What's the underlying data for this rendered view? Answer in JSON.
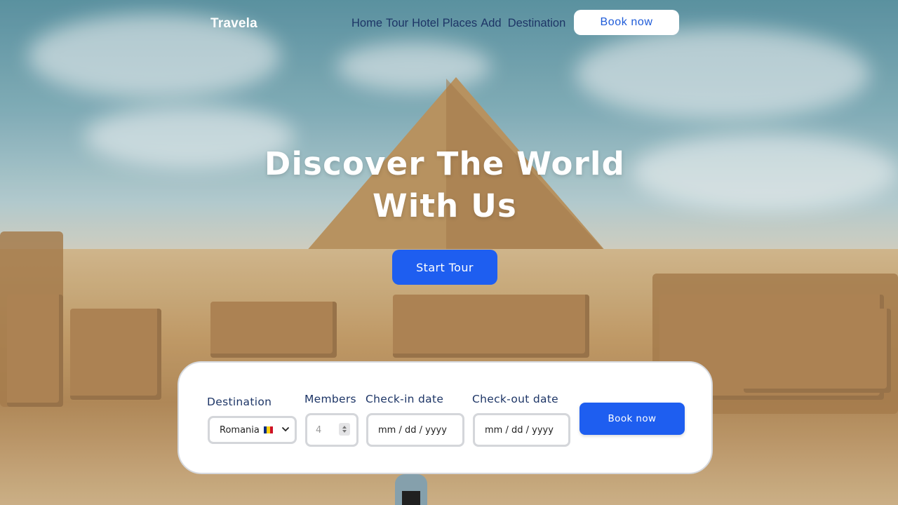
{
  "brand": {
    "name": "Travela",
    "accent": "#1e5ef0",
    "nav_text_color": "#1d3566"
  },
  "nav": {
    "links": [
      "Home",
      "Tour",
      "Hotel",
      "Places",
      "Add  Destination"
    ],
    "book_label": "Book now"
  },
  "hero": {
    "headline_line1": "Discover The World",
    "headline_line2": "With Us",
    "cta_label": "Start Tour",
    "background": "pyramid-of-giza-photo"
  },
  "booking": {
    "destination": {
      "label": "Destination",
      "value": "Romania",
      "icon": "romania-flag-icon"
    },
    "members": {
      "label": "Members",
      "placeholder": "4"
    },
    "checkin": {
      "label": "Check-in date",
      "placeholder": "mm / dd / yyyy"
    },
    "checkout": {
      "label": "Check-out date",
      "placeholder": "mm / dd / yyyy"
    },
    "submit_label": "Book now"
  }
}
